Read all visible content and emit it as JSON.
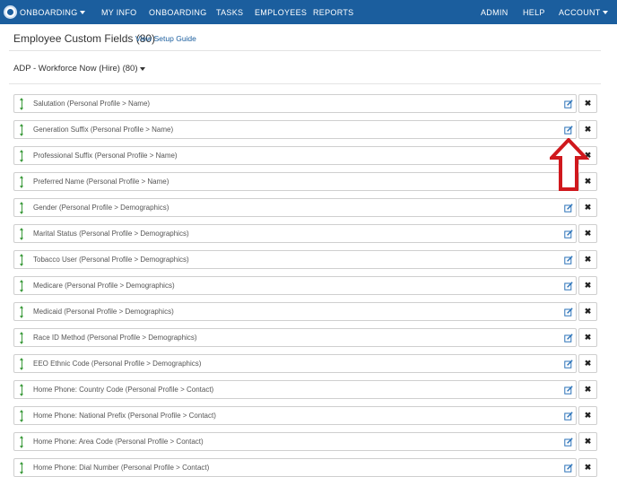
{
  "nav": {
    "brand": "ONBOARDING",
    "left": [
      "MY INFO",
      "ONBOARDING",
      "TASKS",
      "EMPLOYEES",
      "REPORTS"
    ],
    "right": {
      "admin": "ADMIN",
      "help": "HELP",
      "account": "ACCOUNT"
    }
  },
  "header": {
    "title": "Employee Custom Fields (80)",
    "setup_link": "View Setup Guide"
  },
  "section": {
    "title": "ADP - Workforce Now (Hire) (80)"
  },
  "rows": [
    "Salutation (Personal Profile > Name)",
    "Generation Suffix (Personal Profile > Name)",
    "Professional Suffix (Personal Profile > Name)",
    "Preferred Name (Personal Profile > Name)",
    "Gender (Personal Profile > Demographics)",
    "Marital Status (Personal Profile > Demographics)",
    "Tobacco User (Personal Profile > Demographics)",
    "Medicare (Personal Profile > Demographics)",
    "Medicaid (Personal Profile > Demographics)",
    "Race ID Method (Personal Profile > Demographics)",
    "EEO Ethnic Code (Personal Profile > Demographics)",
    "Home Phone: Country Code (Personal Profile > Contact)",
    "Home Phone: National Prefix (Personal Profile > Contact)",
    "Home Phone: Area Code (Personal Profile > Contact)",
    "Home Phone: Dial Number (Personal Profile > Contact)"
  ],
  "delete_glyph": "✖",
  "colors": {
    "navbar": "#1b5e9e",
    "link": "#1b5e9e",
    "drag_arrow": "#3a9a3a",
    "annotation_arrow": "#d0181d"
  },
  "icons": {
    "edit": "edit-icon",
    "delete": "close-icon",
    "drag": "reorder-icon"
  }
}
